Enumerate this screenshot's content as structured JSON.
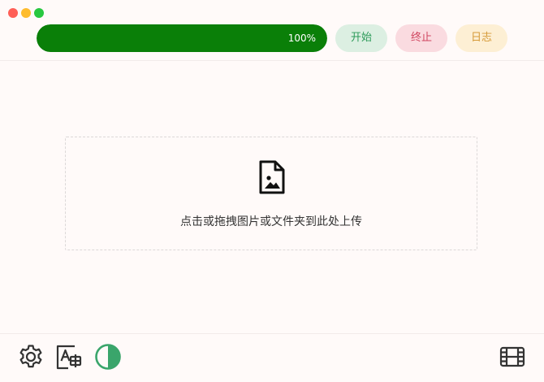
{
  "window": {
    "controls": [
      "close",
      "minimize",
      "maximize"
    ]
  },
  "progress": {
    "value": 1.0,
    "label": "100%",
    "fill_color": "#0a7f08"
  },
  "actions": {
    "start_label": "开始",
    "stop_label": "终止",
    "log_label": "日志"
  },
  "dropzone": {
    "icon": "image-file-icon",
    "text": "点击或拖拽图片或文件夹到此处上传"
  },
  "bottom_toolbar": {
    "left": [
      "gear-icon",
      "font-settings-icon",
      "theme-contrast-icon"
    ],
    "right": [
      "film-icon"
    ],
    "theme_color": "#3aa56b"
  }
}
